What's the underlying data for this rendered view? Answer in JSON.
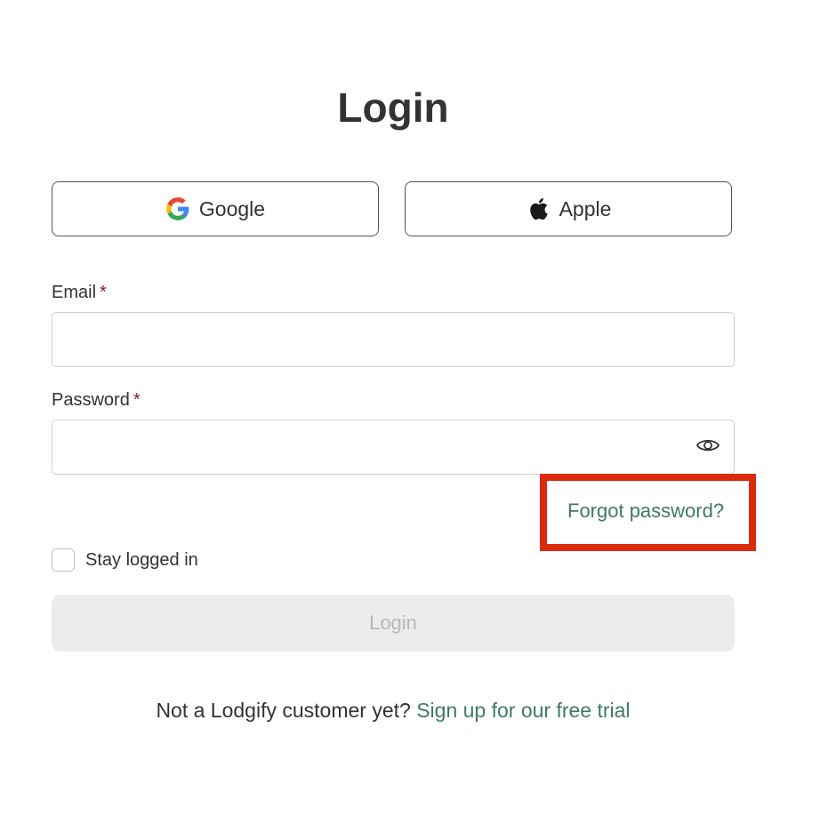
{
  "page": {
    "title": "Login"
  },
  "social": {
    "google_label": "Google",
    "apple_label": "Apple"
  },
  "form": {
    "email_label": "Email",
    "email_value": "",
    "password_label": "Password",
    "password_value": "",
    "required_mark": "*",
    "forgot_password": "Forgot password?",
    "stay_logged_in": "Stay logged in",
    "stay_logged_in_checked": false,
    "login_button": "Login",
    "login_enabled": false
  },
  "footer": {
    "prompt": "Not a Lodgify customer yet?",
    "signup_link": "Sign up for our free trial"
  },
  "icons": {
    "google": "google-logo-icon",
    "apple": "apple-logo-icon",
    "show_password": "eye-icon"
  },
  "colors": {
    "link": "#3e7a63",
    "required": "#8b1a1a",
    "highlight": "#dc2a0c",
    "disabled_button_bg": "#ececec",
    "disabled_button_text": "#b8b8b8"
  }
}
